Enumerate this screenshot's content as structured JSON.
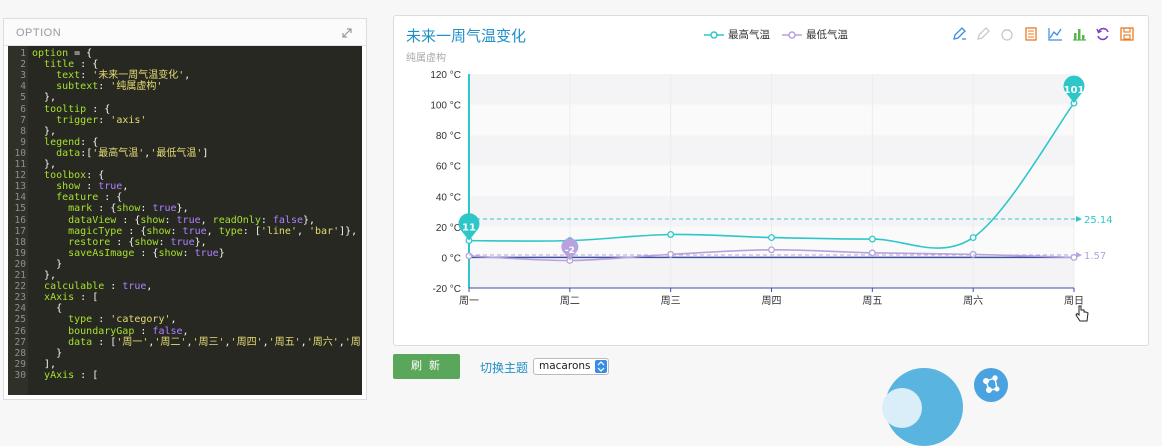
{
  "option_panel": {
    "title": "OPTION",
    "code_lines": [
      {
        "n": "1",
        "t": "option = {"
      },
      {
        "n": "2",
        "t": "  title : {"
      },
      {
        "n": "3",
        "t": "    text: '未来一周气温变化',"
      },
      {
        "n": "4",
        "t": "    subtext: '纯属虚构'"
      },
      {
        "n": "5",
        "t": "  },"
      },
      {
        "n": "6",
        "t": "  tooltip : {"
      },
      {
        "n": "7",
        "t": "    trigger: 'axis'"
      },
      {
        "n": "8",
        "t": "  },"
      },
      {
        "n": "9",
        "t": "  legend: {"
      },
      {
        "n": "10",
        "t": "    data:['最高气温','最低气温']"
      },
      {
        "n": "11",
        "t": "  },"
      },
      {
        "n": "12",
        "t": "  toolbox: {"
      },
      {
        "n": "13",
        "t": "    show : true,"
      },
      {
        "n": "14",
        "t": "    feature : {"
      },
      {
        "n": "15",
        "t": "      mark : {show: true},"
      },
      {
        "n": "16",
        "t": "      dataView : {show: true, readOnly: false},"
      },
      {
        "n": "17",
        "t": "      magicType : {show: true, type: ['line', 'bar']},"
      },
      {
        "n": "18",
        "t": "      restore : {show: true},"
      },
      {
        "n": "19",
        "t": "      saveAsImage : {show: true}"
      },
      {
        "n": "20",
        "t": "    }"
      },
      {
        "n": "21",
        "t": "  },"
      },
      {
        "n": "22",
        "t": "  calculable : true,"
      },
      {
        "n": "23",
        "t": "  xAxis : ["
      },
      {
        "n": "24",
        "t": "    {"
      },
      {
        "n": "25",
        "t": "      type : 'category',"
      },
      {
        "n": "26",
        "t": "      boundaryGap : false,"
      },
      {
        "n": "27",
        "t": "      data : ['周一','周二','周三','周四','周五','周六','周日']"
      },
      {
        "n": "28",
        "t": "    }"
      },
      {
        "n": "29",
        "t": "  ],"
      },
      {
        "n": "30",
        "t": "  yAxis : ["
      }
    ]
  },
  "chart": {
    "title": "未来一周气温变化",
    "subtitle": "纯属虚构",
    "legend": [
      "最高气温",
      "最低气温"
    ],
    "toolbox_icons": [
      "mark-pen-icon",
      "mark-undo-icon",
      "mark-clear-icon",
      "data-view-icon",
      "line-switch-icon",
      "bar-switch-icon",
      "restore-icon",
      "save-image-icon"
    ]
  },
  "chart_data": {
    "type": "line",
    "title": "未来一周气温变化",
    "subtitle": "纯属虚构",
    "categories": [
      "周一",
      "周二",
      "周三",
      "周四",
      "周五",
      "周六",
      "周日"
    ],
    "y_tick_labels": [
      "120 °C",
      "100 °C",
      "80 °C",
      "60 °C",
      "40 °C",
      "20 °C",
      "0 °C",
      "-20 °C"
    ],
    "ylim": [
      -20,
      120
    ],
    "grid": true,
    "legend_position": "top",
    "series": [
      {
        "name": "最高气温",
        "color": "#2ec7c9",
        "values": [
          11,
          11,
          15,
          13,
          12,
          13,
          101
        ],
        "mark_points": {
          "max": "101",
          "min": "11"
        },
        "mark_line_average": "25.14"
      },
      {
        "name": "最低气温",
        "color": "#b6a2de",
        "values": [
          1,
          -2,
          2,
          5,
          3,
          2,
          0
        ],
        "mark_points": {
          "min": "-2"
        },
        "mark_line_average": "1.57"
      }
    ]
  },
  "controls": {
    "refresh_label": "刷 新",
    "theme_label": "切换主题",
    "theme_value": "macarons"
  }
}
